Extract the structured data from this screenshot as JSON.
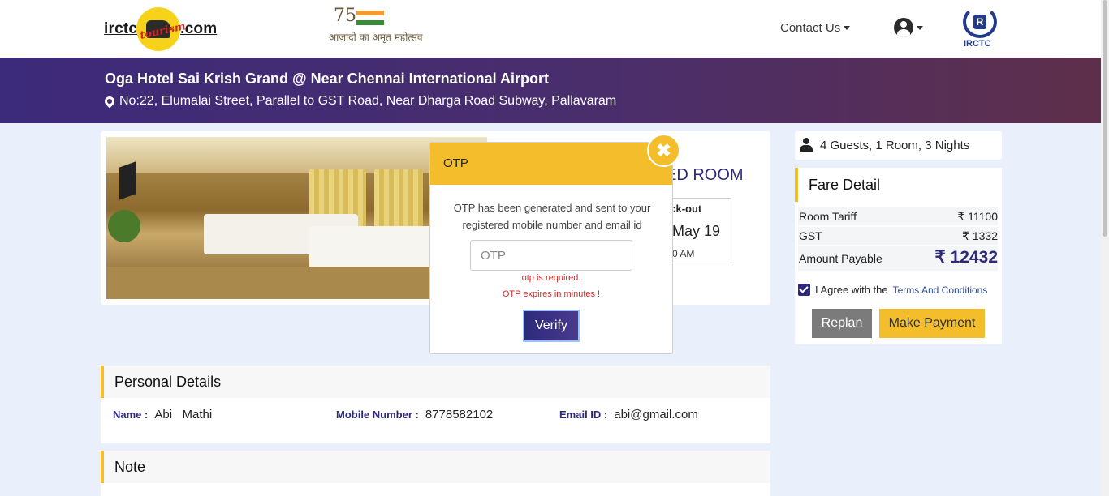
{
  "nav": {
    "logo_left": "irctc",
    "logo_right": ".com",
    "logo_script": "tourism",
    "azadi_num": "75",
    "azadi_text": "आज़ादी का अमृत महोत्सव",
    "contact_label": "Contact Us",
    "irctc_label": "IRCTC"
  },
  "banner": {
    "hotel_name": "Oga Hotel Sai Krish Grand @ Near Chennai International Airport",
    "address": "No:22, Elumalai Street, Parallel to GST Road, Near Dharga Road Subway, Pallavaram"
  },
  "booking": {
    "room_title_visible": "ED ROOM",
    "checkout_label": "eck-out",
    "checkout_date": ", May 19",
    "checkout_time": ":00 AM"
  },
  "summary": {
    "guests": "4 Guests, 1 Room, 3 Nights"
  },
  "fare": {
    "title": "Fare Detail",
    "rows": [
      {
        "label": "Room Tariff",
        "value": "₹ 11100"
      },
      {
        "label": "GST",
        "value": "₹ 1332"
      }
    ],
    "total_label": "Amount Payable",
    "total_value": "₹ 12432",
    "agree_text": "I Agree with the",
    "terms_link": "Terms And Conditions",
    "replan_label": "Replan",
    "pay_label": "Make Payment"
  },
  "personal": {
    "title": "Personal Details",
    "name_label": "Name :",
    "name_value": "Abi   Mathi",
    "mobile_label": "Mobile Number :",
    "mobile_value": "8778582102",
    "email_label": "Email ID :",
    "email_value": "abi@gmail.com"
  },
  "note": {
    "title": "Note"
  },
  "otp_modal": {
    "title": "OTP",
    "close_glyph": "✖",
    "message": "OTP has been generated and sent to your registered mobile number and email id",
    "input_placeholder": "OTP",
    "input_value": "",
    "error_required": "otp is required.",
    "error_expiry": "OTP expires in minutes !",
    "verify_label": "Verify"
  },
  "colors": {
    "accent_yellow": "#f3bd2c",
    "brand_purple": "#2d2a7a",
    "error_red": "#d02b2b"
  }
}
